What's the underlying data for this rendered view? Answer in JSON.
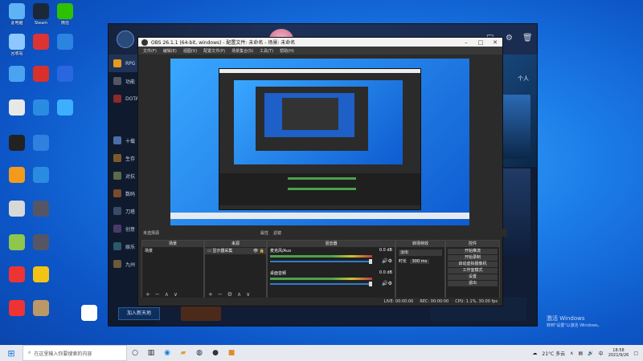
{
  "desktop": {
    "icons": [
      {
        "label": "此电脑",
        "color": "#5fb3f5"
      },
      {
        "label": "Steam",
        "color": "#1b2838"
      },
      {
        "label": "微信",
        "color": "#2dc100"
      },
      {
        "label": "回收站",
        "color": "#8cc8ff"
      },
      {
        "label": "",
        "color": "#d33"
      },
      {
        "label": "",
        "color": "#2b84e0"
      },
      {
        "label": "",
        "color": "#4aa3f0"
      },
      {
        "label": "",
        "color": "#d8312b"
      },
      {
        "label": "",
        "color": "#2867e0"
      },
      {
        "label": "",
        "color": "#e8e8e8"
      },
      {
        "label": "",
        "color": "#2a8ce0"
      },
      {
        "label": "",
        "color": "#3cb0ff"
      },
      {
        "label": "",
        "color": "#222"
      },
      {
        "label": "",
        "color": "#3080e0"
      },
      {
        "label": "",
        "color": "#f29a1c"
      },
      {
        "label": "",
        "color": "#2a8ce0"
      },
      {
        "label": "",
        "color": "#d8d8d8"
      },
      {
        "label": "",
        "color": "#556"
      },
      {
        "label": "",
        "color": "#8fc64b"
      },
      {
        "label": "",
        "color": "#556"
      },
      {
        "label": "",
        "color": "#e33"
      },
      {
        "label": "",
        "color": "#f3c414"
      },
      {
        "label": "",
        "color": "#e33"
      },
      {
        "label": "",
        "color": "#b96"
      },
      {
        "label": "",
        "color": "#fff"
      }
    ]
  },
  "launcher": {
    "sidebar": [
      {
        "label": "RPG",
        "color": "#e89b1c"
      },
      {
        "label": "功能",
        "color": "#556"
      },
      {
        "label": "DOTA",
        "color": "#8a2b2b"
      },
      {
        "label": "十载",
        "color": "#4a6fa5"
      },
      {
        "label": "生存",
        "color": "#7a5a2a"
      },
      {
        "label": "对抗",
        "color": "#5a6a4a"
      },
      {
        "label": "数码",
        "color": "#7a4a2a"
      },
      {
        "label": "刀塔",
        "color": "#3a4a6a"
      },
      {
        "label": "创意",
        "color": "#4a3a6a"
      },
      {
        "label": "娱乐",
        "color": "#2a5a6a"
      },
      {
        "label": "九州",
        "color": "#6a5a3a"
      }
    ],
    "launch_label": "加入新天地",
    "top_right_badge": "个人"
  },
  "obs": {
    "title": "OBS 26.1.1 (64-bit, windows) - 配置文件: 未命名 - 场景: 未命名",
    "menu": [
      "文件(F)",
      "编辑(E)",
      "视图(V)",
      "配置文件(P)",
      "场景集合(S)",
      "工具(T)",
      "帮助(H)"
    ],
    "scene_bar": [
      "未选择源",
      "属性",
      "滤镜"
    ],
    "docks": {
      "scenes": {
        "title": "场景",
        "items": [
          "场景"
        ]
      },
      "sources": {
        "title": "来源",
        "items": [
          "显示器采集"
        ]
      },
      "mixer": {
        "title": "混音器",
        "tracks": [
          {
            "name": "麦克风/Aux",
            "db": "0.0 dB"
          },
          {
            "name": "桌面音频",
            "db": "0.0 dB"
          }
        ]
      },
      "transitions": {
        "title": "转场特效",
        "type": "淡出",
        "duration_label": "时长",
        "duration": "300 ms"
      },
      "controls": {
        "title": "控件",
        "buttons": [
          "开始推流",
          "开始录制",
          "启动虚拟摄像机",
          "工作室模式",
          "设置",
          "退出"
        ]
      }
    },
    "status": {
      "live": "LIVE: 00:00:00",
      "rec": "REC: 00:00:00",
      "cpu": "CPU: 1.1%, 30.00 fps"
    }
  },
  "taskbar": {
    "search_placeholder": "在这里输入你要搜索的内容",
    "weather": "21°C 多云",
    "time": "18:58",
    "date": "2021/9/26"
  },
  "watermark": {
    "title": "激活 Windows",
    "sub": "转到\"设置\"以激活 Windows。"
  }
}
